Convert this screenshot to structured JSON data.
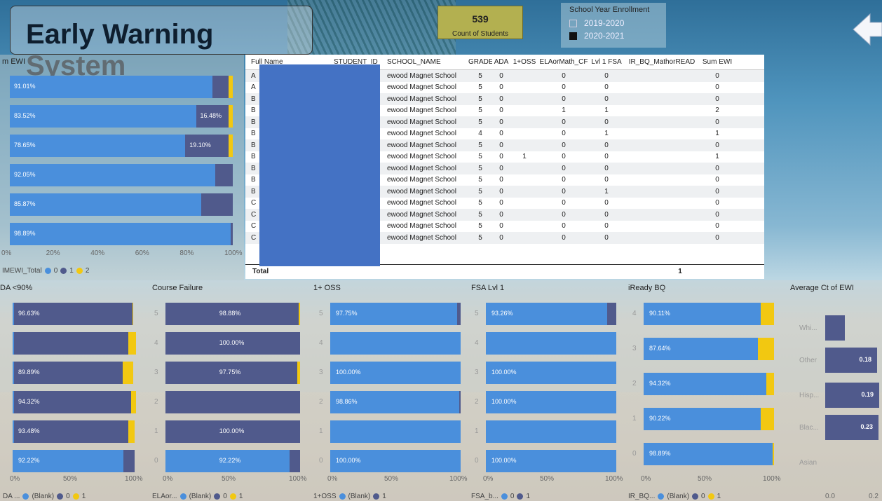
{
  "header": {
    "title": "Early Warning System",
    "count_value": "539",
    "count_label": "Count of Students",
    "filter_title": "School Year Enrollment",
    "years": [
      {
        "label": "2019-2020",
        "checked": false
      },
      {
        "label": "2020-2021",
        "checked": true
      }
    ]
  },
  "sum_ewi": {
    "title": "m EWI",
    "rows": [
      {
        "main": "91.01%",
        "second": ""
      },
      {
        "main": "83.52%",
        "second": "16.48%"
      },
      {
        "main": "78.65%",
        "second": "19.10%"
      },
      {
        "main": "92.05%",
        "second": ""
      },
      {
        "main": "85.87%",
        "second": ""
      },
      {
        "main": "98.89%",
        "second": ""
      }
    ],
    "ticks": [
      "0%",
      "20%",
      "40%",
      "60%",
      "80%",
      "100%"
    ],
    "legend_title": "IMEWI_Total",
    "legend": [
      "0",
      "1",
      "2"
    ]
  },
  "table": {
    "headers": [
      "Full Name",
      "STUDENT_ID",
      "SCHOOL_NAME",
      "GRADE",
      "ADA",
      "1+OSS",
      "ELAorMath_CF",
      "Lvl 1 FSA",
      "IR_BQ_MathorREAD",
      "Sum EWI"
    ],
    "rows": [
      [
        "A",
        "",
        "ewood Magnet School",
        "5",
        "0",
        "",
        "0",
        "0",
        "",
        "0"
      ],
      [
        "A",
        "",
        "ewood Magnet School",
        "5",
        "0",
        "",
        "0",
        "0",
        "",
        "0"
      ],
      [
        "B",
        "",
        "ewood Magnet School",
        "5",
        "0",
        "",
        "0",
        "0",
        "",
        "0"
      ],
      [
        "B",
        "",
        "ewood Magnet School",
        "5",
        "0",
        "",
        "1",
        "1",
        "",
        "2"
      ],
      [
        "B",
        "",
        "ewood Magnet School",
        "5",
        "0",
        "",
        "0",
        "0",
        "",
        "0"
      ],
      [
        "B",
        "",
        "ewood Magnet School",
        "4",
        "0",
        "",
        "0",
        "1",
        "",
        "1"
      ],
      [
        "B",
        "",
        "ewood Magnet School",
        "5",
        "0",
        "",
        "0",
        "0",
        "",
        "0"
      ],
      [
        "B",
        "",
        "ewood Magnet School",
        "5",
        "0",
        "1",
        "0",
        "0",
        "",
        "1"
      ],
      [
        "B",
        "",
        "ewood Magnet School",
        "5",
        "0",
        "",
        "0",
        "0",
        "",
        "0"
      ],
      [
        "B",
        "",
        "ewood Magnet School",
        "5",
        "0",
        "",
        "0",
        "0",
        "",
        "0"
      ],
      [
        "B",
        "",
        "ewood Magnet School",
        "5",
        "0",
        "",
        "0",
        "1",
        "",
        "0"
      ],
      [
        "C",
        "",
        "ewood Magnet School",
        "5",
        "0",
        "",
        "0",
        "0",
        "",
        "0"
      ],
      [
        "C",
        "",
        "ewood Magnet School",
        "5",
        "0",
        "",
        "0",
        "0",
        "",
        "0"
      ],
      [
        "C",
        "",
        "ewood Magnet School",
        "5",
        "0",
        "",
        "0",
        "0",
        "",
        "0"
      ],
      [
        "C",
        "",
        "ewood Magnet School",
        "5",
        "0",
        "",
        "0",
        "0",
        "",
        "0"
      ]
    ],
    "total_label": "Total",
    "total_value": "1"
  },
  "ada": {
    "title": "DA <90%",
    "rows": [
      "96.63%",
      "",
      "89.89%",
      "94.32%",
      "93.48%",
      "92.22%"
    ],
    "ticks": [
      "0%",
      "50%",
      "100%"
    ],
    "legend_title": "DA ...",
    "legend": [
      "(Blank)",
      "0",
      "1"
    ]
  },
  "course": {
    "title": "Course Failure",
    "cats": [
      "5",
      "4",
      "3",
      "2",
      "1",
      "0"
    ],
    "rows": [
      "98.88%",
      "100.00%",
      "97.75%",
      "",
      "100.00%",
      "92.22%"
    ],
    "ticks": [
      "0%",
      "50%",
      "100%"
    ],
    "legend_title": "ELAor...",
    "legend": [
      "(Blank)",
      "0",
      "1"
    ]
  },
  "oss": {
    "title": "1+ OSS",
    "cats": [
      "5",
      "4",
      "3",
      "2",
      "1",
      "0"
    ],
    "rows": [
      "97.75%",
      "",
      "100.00%",
      "98.86%",
      "",
      "100.00%"
    ],
    "ticks": [
      "0%",
      "50%",
      "100%"
    ],
    "legend_title": "1+OSS",
    "legend": [
      "(Blank)",
      "1"
    ]
  },
  "fsa": {
    "title": "FSA Lvl 1",
    "cats": [
      "5",
      "4",
      "3",
      "2",
      "1",
      "0"
    ],
    "rows": [
      "93.26%",
      "",
      "100.00%",
      "100.00%",
      "",
      "100.00%"
    ],
    "ticks": [
      "0%",
      "50%",
      "100%"
    ],
    "legend_title": "FSA_b...",
    "legend": [
      "0",
      "1"
    ]
  },
  "iready": {
    "title": "iReady BQ",
    "cats": [
      "4",
      "3",
      "2",
      "1",
      "0"
    ],
    "rows": [
      "90.11%",
      "87.64%",
      "94.32%",
      "90.22%",
      "98.89%"
    ],
    "ticks": [
      "0%",
      "50%",
      "100%"
    ],
    "legend_title": "IR_BQ...",
    "legend": [
      "(Blank)",
      "0",
      "1"
    ]
  },
  "avg": {
    "title": "Average Ct of EWI",
    "cats": [
      "Whi...",
      "Other",
      "Hisp...",
      "Blac...",
      "Asian"
    ],
    "values": [
      "",
      "0.18",
      "0.19",
      "0.23",
      ""
    ],
    "ticks": [
      "0.0",
      "0.2"
    ]
  },
  "colors": {
    "blue": "#4a8fdc",
    "navy": "#505a8c",
    "yellow": "#f2c811",
    "redact": "#4472c4"
  }
}
